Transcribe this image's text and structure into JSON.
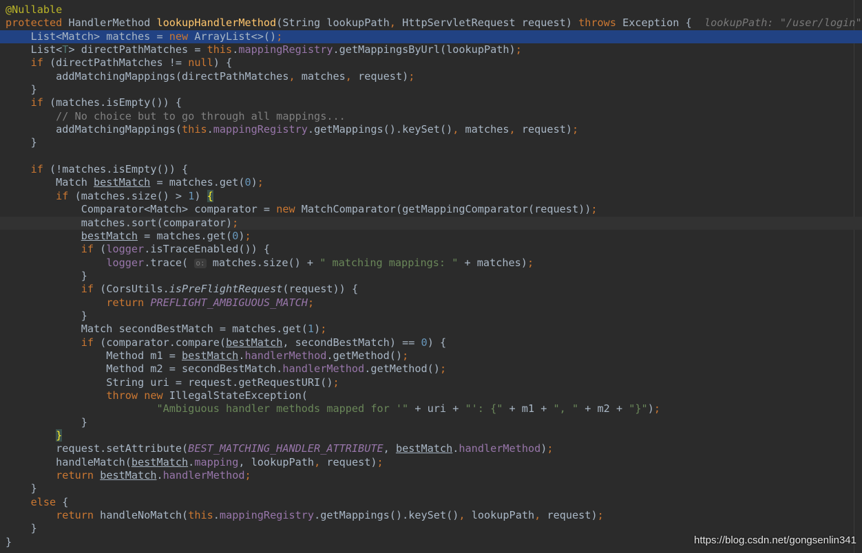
{
  "editor": {
    "background": "#2b2b2b",
    "selection_color": "#214283",
    "keyword_color": "#cc7832",
    "method_color": "#ffc66d",
    "field_color": "#9876aa",
    "string_color": "#6a8759",
    "number_color": "#6897bb",
    "comment_color": "#808080",
    "annotation_color": "#bbb529",
    "selected_line": 2,
    "caret_line": 16,
    "lines": [
      [
        {
          "t": "@Nullable",
          "c": "ann"
        }
      ],
      [
        {
          "t": "protected",
          "c": "kw"
        },
        {
          "t": " HandlerMethod "
        },
        {
          "t": "lookupHandlerMethod",
          "c": "fn"
        },
        {
          "t": "(String lookupPath"
        },
        {
          "t": ",",
          "c": "kw"
        },
        {
          "t": " HttpServletRequest request) "
        },
        {
          "t": "throws",
          "c": "kw"
        },
        {
          "t": " Exception {  "
        },
        {
          "t": "lookupPath: \"/user/login\"",
          "c": "hint"
        }
      ],
      [
        {
          "t": "    List<Match> matches = "
        },
        {
          "t": "new",
          "c": "kw"
        },
        {
          "t": " ArrayList<>()"
        },
        {
          "t": ";",
          "c": "kw"
        }
      ],
      [
        {
          "t": "    List<"
        },
        {
          "t": "T",
          "c": "gen"
        },
        {
          "t": "> directPathMatches = "
        },
        {
          "t": "this",
          "c": "kw"
        },
        {
          "t": "."
        },
        {
          "t": "mappingRegistry",
          "c": "fld"
        },
        {
          "t": ".getMappingsByUrl(lookupPath)"
        },
        {
          "t": ";",
          "c": "kw"
        }
      ],
      [
        {
          "t": "    "
        },
        {
          "t": "if",
          "c": "kw"
        },
        {
          "t": " (directPathMatches != "
        },
        {
          "t": "null",
          "c": "kw"
        },
        {
          "t": ") {"
        }
      ],
      [
        {
          "t": "        addMatchingMappings(directPathMatches"
        },
        {
          "t": ",",
          "c": "kw"
        },
        {
          "t": " matches"
        },
        {
          "t": ",",
          "c": "kw"
        },
        {
          "t": " request)"
        },
        {
          "t": ";",
          "c": "kw"
        }
      ],
      [
        {
          "t": "    }"
        }
      ],
      [
        {
          "t": "    "
        },
        {
          "t": "if",
          "c": "kw"
        },
        {
          "t": " (matches.isEmpty()) {"
        }
      ],
      [
        {
          "t": "        "
        },
        {
          "t": "// No choice but to go through all mappings...",
          "c": "cmt"
        }
      ],
      [
        {
          "t": "        addMatchingMappings("
        },
        {
          "t": "this",
          "c": "kw"
        },
        {
          "t": "."
        },
        {
          "t": "mappingRegistry",
          "c": "fld"
        },
        {
          "t": ".getMappings().keySet()"
        },
        {
          "t": ",",
          "c": "kw"
        },
        {
          "t": " matches"
        },
        {
          "t": ",",
          "c": "kw"
        },
        {
          "t": " request)"
        },
        {
          "t": ";",
          "c": "kw"
        }
      ],
      [
        {
          "t": "    }"
        }
      ],
      [
        {
          "t": ""
        }
      ],
      [
        {
          "t": "    "
        },
        {
          "t": "if",
          "c": "kw"
        },
        {
          "t": " (!matches.isEmpty()) {"
        }
      ],
      [
        {
          "t": "        Match "
        },
        {
          "t": "bestMatch",
          "c": "ul"
        },
        {
          "t": " = matches.get("
        },
        {
          "t": "0",
          "c": "num"
        },
        {
          "t": ")"
        },
        {
          "t": ";",
          "c": "kw"
        }
      ],
      [
        {
          "t": "        "
        },
        {
          "t": "if",
          "c": "kw"
        },
        {
          "t": " (matches.size() > "
        },
        {
          "t": "1",
          "c": "num"
        },
        {
          "t": ") "
        },
        {
          "t": "{",
          "c": "brace"
        }
      ],
      [
        {
          "t": "            Comparator<Match> comparator = "
        },
        {
          "t": "new",
          "c": "kw"
        },
        {
          "t": " MatchComparator(getMappingComparator(request))"
        },
        {
          "t": ";",
          "c": "kw"
        }
      ],
      [
        {
          "t": "            matches.sort(comparator)"
        },
        {
          "t": ";",
          "c": "kw"
        }
      ],
      [
        {
          "t": "            "
        },
        {
          "t": "bestMatch",
          "c": "ul"
        },
        {
          "t": " = matches.get("
        },
        {
          "t": "0",
          "c": "num"
        },
        {
          "t": ")"
        },
        {
          "t": ";",
          "c": "kw"
        }
      ],
      [
        {
          "t": "            "
        },
        {
          "t": "if",
          "c": "kw"
        },
        {
          "t": " ("
        },
        {
          "t": "logger",
          "c": "fld"
        },
        {
          "t": ".isTraceEnabled()) {"
        }
      ],
      [
        {
          "t": "                "
        },
        {
          "t": "logger",
          "c": "fld"
        },
        {
          "t": ".trace( "
        },
        {
          "t": "o:",
          "c": "inlay"
        },
        {
          "t": " matches.size() + "
        },
        {
          "t": "\" matching mappings: \"",
          "c": "str"
        },
        {
          "t": " + matches)"
        },
        {
          "t": ";",
          "c": "kw"
        }
      ],
      [
        {
          "t": "            }"
        }
      ],
      [
        {
          "t": "            "
        },
        {
          "t": "if",
          "c": "kw"
        },
        {
          "t": " (CorsUtils."
        },
        {
          "t": "isPreFlightRequest",
          "c": "it"
        },
        {
          "t": "(request)) {"
        }
      ],
      [
        {
          "t": "                "
        },
        {
          "t": "return",
          "c": "kw"
        },
        {
          "t": " "
        },
        {
          "t": "PREFLIGHT_AMBIGUOUS_MATCH",
          "c": "cst"
        },
        {
          "t": ";",
          "c": "kw"
        }
      ],
      [
        {
          "t": "            }"
        }
      ],
      [
        {
          "t": "            Match secondBestMatch = matches.get("
        },
        {
          "t": "1",
          "c": "num"
        },
        {
          "t": ")"
        },
        {
          "t": ";",
          "c": "kw"
        }
      ],
      [
        {
          "t": "            "
        },
        {
          "t": "if",
          "c": "kw"
        },
        {
          "t": " (comparator.compare("
        },
        {
          "t": "bestMatch",
          "c": "ul"
        },
        {
          "t": ","
        },
        {
          "t": " secondBestMatch) == "
        },
        {
          "t": "0",
          "c": "num"
        },
        {
          "t": ") {"
        }
      ],
      [
        {
          "t": "                Method m1 = "
        },
        {
          "t": "bestMatch",
          "c": "ul"
        },
        {
          "t": "."
        },
        {
          "t": "handlerMethod",
          "c": "fld"
        },
        {
          "t": ".getMethod()"
        },
        {
          "t": ";",
          "c": "kw"
        }
      ],
      [
        {
          "t": "                Method m2 = secondBestMatch."
        },
        {
          "t": "handlerMethod",
          "c": "fld"
        },
        {
          "t": ".getMethod()"
        },
        {
          "t": ";",
          "c": "kw"
        }
      ],
      [
        {
          "t": "                String uri = request.getRequestURI()"
        },
        {
          "t": ";",
          "c": "kw"
        }
      ],
      [
        {
          "t": "                "
        },
        {
          "t": "throw",
          "c": "kw"
        },
        {
          "t": " "
        },
        {
          "t": "new",
          "c": "kw"
        },
        {
          "t": " IllegalStateException("
        }
      ],
      [
        {
          "t": "                        "
        },
        {
          "t": "\"Ambiguous handler methods mapped for '\"",
          "c": "str"
        },
        {
          "t": " + uri + "
        },
        {
          "t": "\"': {\"",
          "c": "str"
        },
        {
          "t": " + m1 + "
        },
        {
          "t": "\", \"",
          "c": "str"
        },
        {
          "t": " + m2 + "
        },
        {
          "t": "\"}\"",
          "c": "str"
        },
        {
          "t": ")"
        },
        {
          "t": ";",
          "c": "kw"
        }
      ],
      [
        {
          "t": "            }"
        }
      ],
      [
        {
          "t": "        "
        },
        {
          "t": "}",
          "c": "brace"
        }
      ],
      [
        {
          "t": "        request.setAttribute("
        },
        {
          "t": "BEST_MATCHING_HANDLER_ATTRIBUTE",
          "c": "cst"
        },
        {
          "t": ","
        },
        {
          "t": " "
        },
        {
          "t": "bestMatch",
          "c": "ul"
        },
        {
          "t": "."
        },
        {
          "t": "handlerMethod",
          "c": "fld"
        },
        {
          "t": ")"
        },
        {
          "t": ";",
          "c": "kw"
        }
      ],
      [
        {
          "t": "        handleMatch("
        },
        {
          "t": "bestMatch",
          "c": "ul"
        },
        {
          "t": "."
        },
        {
          "t": "mapping",
          "c": "fld"
        },
        {
          "t": ","
        },
        {
          "t": " lookupPath"
        },
        {
          "t": ",",
          "c": "kw"
        },
        {
          "t": " request)"
        },
        {
          "t": ";",
          "c": "kw"
        }
      ],
      [
        {
          "t": "        "
        },
        {
          "t": "return",
          "c": "kw"
        },
        {
          "t": " "
        },
        {
          "t": "bestMatch",
          "c": "ul"
        },
        {
          "t": "."
        },
        {
          "t": "handlerMethod",
          "c": "fld"
        },
        {
          "t": ";",
          "c": "kw"
        }
      ],
      [
        {
          "t": "    }"
        }
      ],
      [
        {
          "t": "    "
        },
        {
          "t": "else",
          "c": "kw"
        },
        {
          "t": " {"
        }
      ],
      [
        {
          "t": "        "
        },
        {
          "t": "return",
          "c": "kw"
        },
        {
          "t": " handleNoMatch("
        },
        {
          "t": "this",
          "c": "kw"
        },
        {
          "t": "."
        },
        {
          "t": "mappingRegistry",
          "c": "fld"
        },
        {
          "t": ".getMappings().keySet()"
        },
        {
          "t": ",",
          "c": "kw"
        },
        {
          "t": " lookupPath"
        },
        {
          "t": ",",
          "c": "kw"
        },
        {
          "t": " request)"
        },
        {
          "t": ";",
          "c": "kw"
        }
      ],
      [
        {
          "t": "    }"
        }
      ],
      [
        {
          "t": "}"
        }
      ]
    ]
  },
  "watermark": "https://blog.csdn.net/gongsenlin341"
}
